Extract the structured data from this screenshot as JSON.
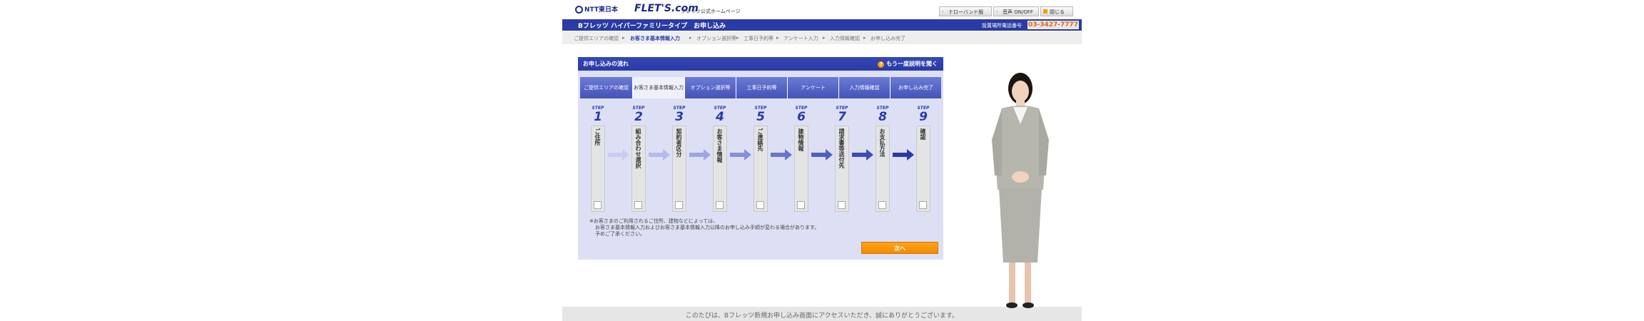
{
  "header": {
    "ntt_logo": "NTT東日本",
    "flets_logo": "FLET'S.com",
    "flets_sub": "フレッツ公式ホームページ",
    "buttons": [
      "ナローバンド版",
      "音声 ON/OFF",
      "閉じる"
    ]
  },
  "title_bar": {
    "title": "Bフレッツ ハイパーファミリータイプ　お申し込み",
    "phone_label": "設置場所電話番号",
    "phone": "03-3427-7777"
  },
  "breadcrumb": [
    "ご提供エリアの確認",
    "お客さま基本情報入力",
    "オプション選択等",
    "工事日予約等",
    "アンケート入力",
    "入力情報確認",
    "お申し込み完了"
  ],
  "breadcrumb_sep": "▸",
  "panel": {
    "title": "お申し込みの流れ",
    "help": "もう一度説明を聞く",
    "help_mark": "?",
    "tabs": [
      "ご提供エリアの確認",
      "お客さま基本情報入力",
      "オプション選択等",
      "工事日予約等",
      "アンケート",
      "入力情報確認",
      "お申し込み完了"
    ],
    "steps": [
      {
        "label": "STEP",
        "num": "1",
        "text": "ご住所"
      },
      {
        "label": "STEP",
        "num": "2",
        "text": "組み合わせ選択"
      },
      {
        "label": "STEP",
        "num": "3",
        "text": "契約者区分"
      },
      {
        "label": "STEP",
        "num": "4",
        "text": "お客さま情報"
      },
      {
        "label": "STEP",
        "num": "5",
        "text": "ご連絡先"
      },
      {
        "label": "STEP",
        "num": "6",
        "text": "建物情報"
      },
      {
        "label": "STEP",
        "num": "7",
        "text": "請求書等送付先"
      },
      {
        "label": "STEP",
        "num": "8",
        "text": "お支払方法"
      },
      {
        "label": "STEP",
        "num": "9",
        "text": "確認"
      }
    ],
    "note_line1": "※お客さまのご利用されるご住所、建物などによっては、",
    "note_line2": "お客さま基本情報入力およびお客さま基本情報入力以降のお申し込み手順が変わる場合があります。",
    "note_line3": "予めご了承ください。",
    "next_button": "次へ"
  },
  "footer_text": "このたびは、Bフレッツ新規お申し込み画面にアクセスいただき、誠にありがとうございます。",
  "colors": {
    "brand": "#2a3aa6",
    "accent": "#f28b00",
    "phone": "#e06a00"
  }
}
